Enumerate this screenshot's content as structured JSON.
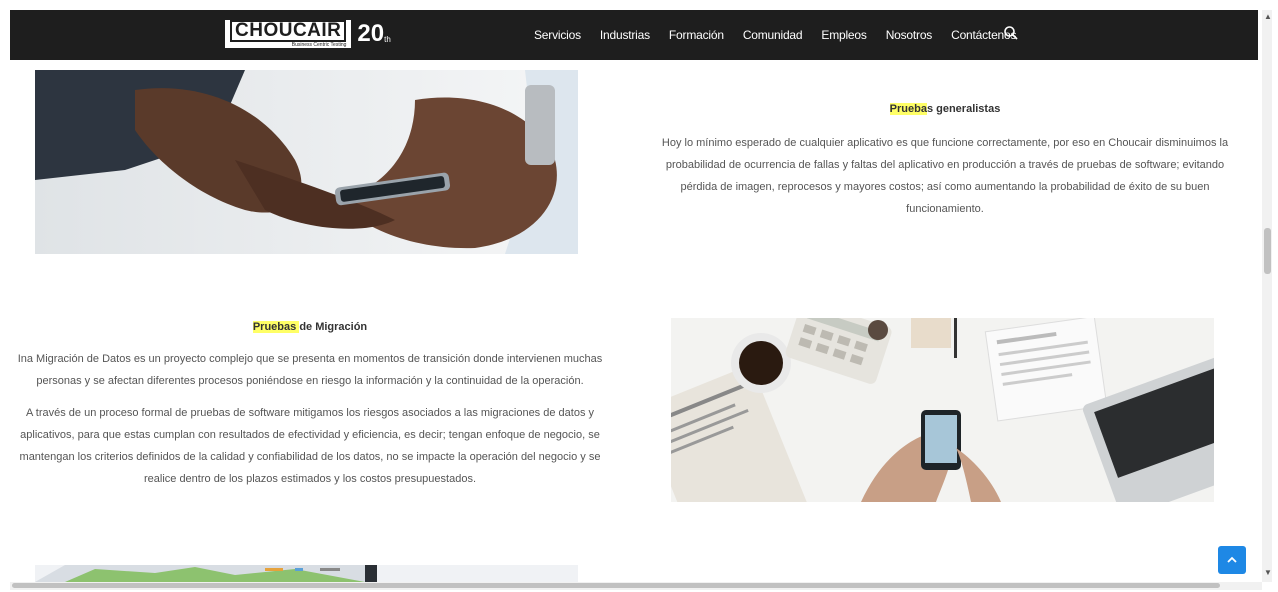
{
  "nav": {
    "logo_word": "CHOUCAIR",
    "logo_tagline": "Business Centric Testing",
    "logo_number": "20",
    "logo_suffix": "th",
    "items": [
      "Servicios",
      "Industrias",
      "Formación",
      "Comunidad",
      "Empleos",
      "Nosotros",
      "Contáctenos"
    ]
  },
  "section1": {
    "title_highlight": "Prueba",
    "title_rest": "s generalistas",
    "body": "Hoy lo mínimo esperado de cualquier aplicativo es que funcione correctamente, por eso en Choucair disminuimos la probabilidad de ocurrencia de fallas y faltas del aplicativo en producción a través de pruebas de software; evitando pérdida de imagen, reprocesos y mayores costos; así como aumentando la probabilidad de éxito de su buen funcionamiento."
  },
  "section2": {
    "title_highlight": "Pruebas ",
    "title_rest": "de Migración",
    "para1": "Ina Migración de Datos es un proyecto complejo que se presenta en momentos de transición donde intervienen muchas personas y se afectan diferentes procesos poniéndose en riesgo la información y la continuidad de la operación.",
    "para2": "A través de un proceso formal de pruebas de software mitigamos los riesgos asociados a las migraciones de datos y aplicativos, para que estas cumplan con resultados de efectividad y eficiencia, es decir; tengan enfoque de negocio, se mantengan los criterios definidos de la calidad y confiabilidad de los datos, no se impacte la operación del negocio y se realice dentro de los plazos estimados y los costos presupuestados."
  },
  "icons": {
    "search": "search-icon",
    "back_to_top": "chevron-up-icon"
  },
  "colors": {
    "navbar": "#1e1e1e",
    "highlight": "#ffff66",
    "back_to_top": "#1e88e5"
  }
}
